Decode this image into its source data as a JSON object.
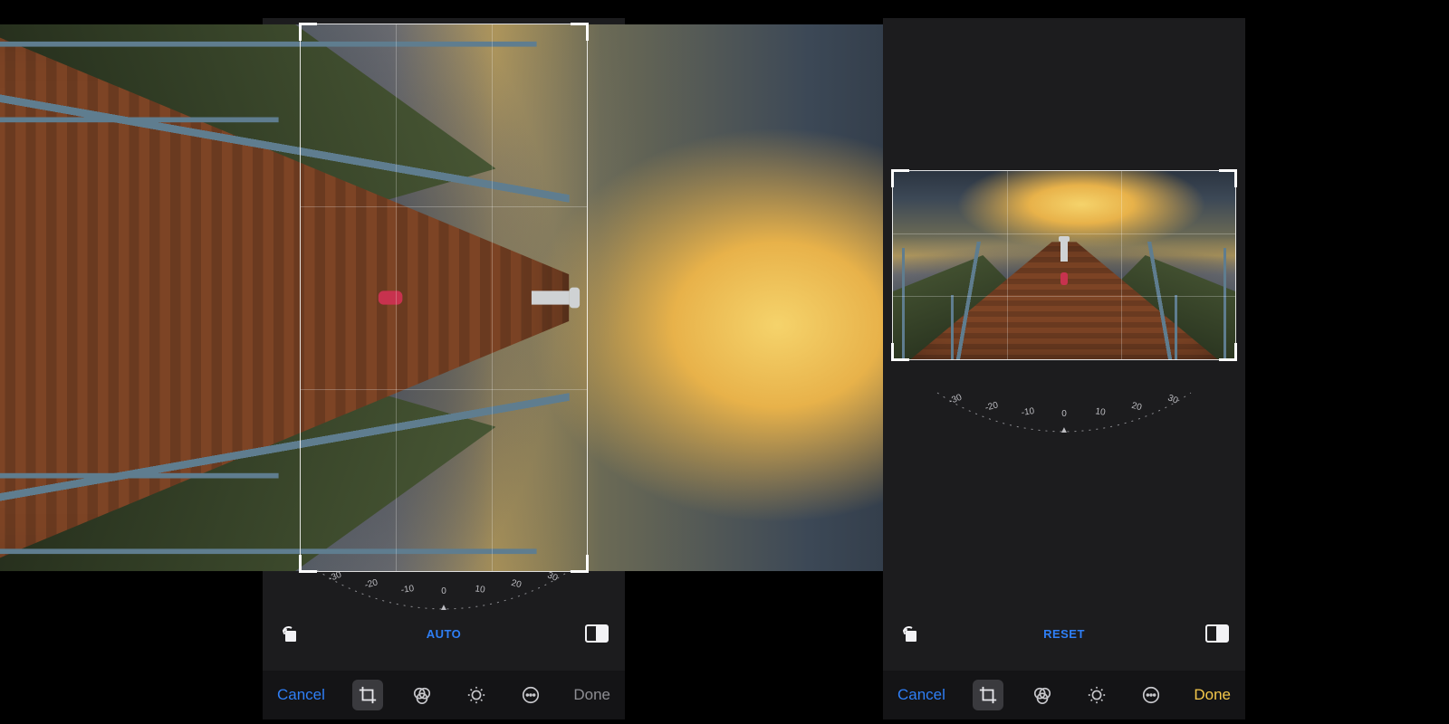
{
  "rotation_dial": {
    "ticks": [
      "-30",
      "-20",
      "-10",
      "0",
      "10",
      "20",
      "30"
    ],
    "current": 0,
    "pointer_glyph": "▲"
  },
  "screens": {
    "left": {
      "mid_button_label": "AUTO",
      "cancel_label": "Cancel",
      "done_label": "Done",
      "done_style": "grey",
      "image_orientation": "rotated-left"
    },
    "right": {
      "mid_button_label": "RESET",
      "cancel_label": "Cancel",
      "done_label": "Done",
      "done_style": "yellow",
      "image_orientation": "landscape"
    }
  },
  "tools": {
    "rotate_icon": "rotate",
    "aspect_icon": "aspect",
    "crop": "Crop",
    "filters": "Filters",
    "adjust": "Adjust",
    "more": "More",
    "active": "crop"
  },
  "colors": {
    "accent_blue": "#2f7ff6",
    "accent_yellow": "#f5c84b",
    "bg": "#1c1c1e"
  }
}
